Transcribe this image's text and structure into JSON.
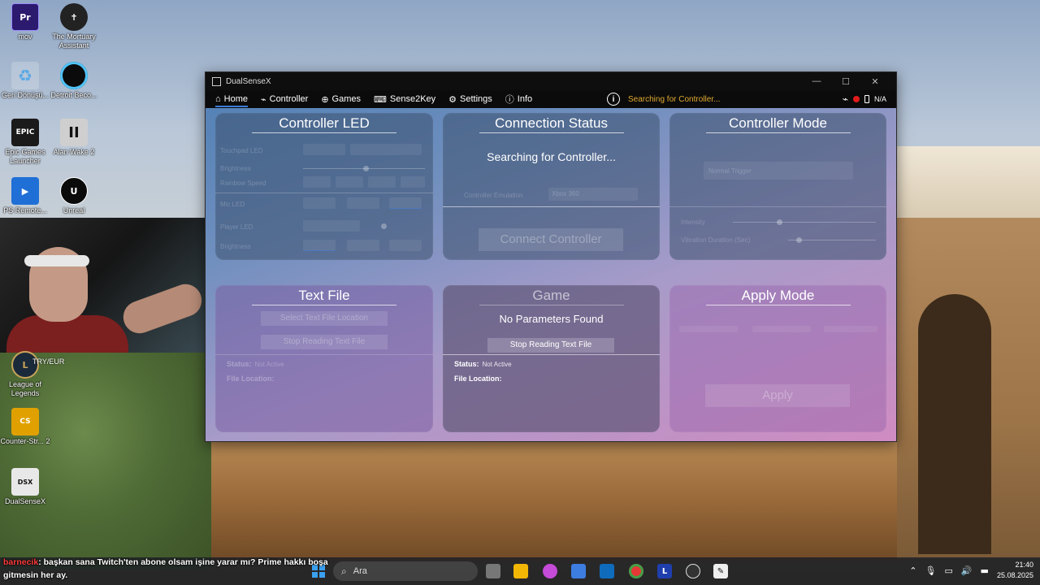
{
  "desktop": {
    "icons": [
      {
        "label": "mov",
        "glyph": "Pr",
        "color": "#2b1a6e"
      },
      {
        "label": "The Mortuary Assistant",
        "glyph": "",
        "color": "#222222"
      },
      {
        "label": "Geri Dönüşü...",
        "glyph": "♻",
        "color": "#5aa9e6"
      },
      {
        "label": "Detroit Beco...",
        "glyph": "",
        "color": "#0b0b0b"
      },
      {
        "label": "Epic Games Launcher",
        "glyph": "EPIC",
        "color": "#1a1a1a"
      },
      {
        "label": "Alan Wake 2",
        "glyph": "II",
        "color": "#cfcfcf"
      },
      {
        "label": "PS Remote...",
        "glyph": "▶",
        "color": "#1f6fd6"
      },
      {
        "label": "Unreal",
        "glyph": "U",
        "color": "#0b0b0b"
      },
      {
        "label": "League of Legends",
        "glyph": "L",
        "color": "#1b2a3a"
      },
      {
        "label": "Counter-Str... 2",
        "glyph": "CS",
        "color": "#e0a100"
      },
      {
        "label": "DualSenseX",
        "glyph": "DSX",
        "color": "#e8e8e8"
      }
    ],
    "mortuary_extra": "TRY/EUR"
  },
  "window": {
    "title": "DualSenseX",
    "controls": {
      "minimize": "—",
      "maximize": "☐",
      "close": "✕"
    },
    "nav": [
      {
        "label": "Home",
        "icon": "home-icon",
        "glyph": "⌂"
      },
      {
        "label": "Controller",
        "icon": "gamepad-icon",
        "glyph": "🎮"
      },
      {
        "label": "Games",
        "icon": "games-icon",
        "glyph": "⊕"
      },
      {
        "label": "Sense2Key",
        "icon": "keyboard-icon",
        "glyph": "⌨"
      },
      {
        "label": "Settings",
        "icon": "settings-icon",
        "glyph": "⚙"
      },
      {
        "label": "Info",
        "icon": "info-icon",
        "glyph": "ⓘ"
      }
    ],
    "status_text": "Searching for Controller...",
    "battery_text": "N/A"
  },
  "panels": {
    "controller_led": {
      "title": "Controller LED",
      "touchpad_led": "Touchpad LED",
      "brightness": "Brightness",
      "rainbow_speed": "Rainbow Speed",
      "mic_led": "Mic LED",
      "player_led": "Player LED",
      "brightness2": "Brightness"
    },
    "connection_status": {
      "title": "Connection Status",
      "message": "Searching for Controller...",
      "emulation_label": "Controller Emulation",
      "emulation_value": "Xbox 360",
      "connect_button": "Connect Controller"
    },
    "controller_mode": {
      "title": "Controller Mode",
      "mode_value": "Normal Trigger",
      "intensity": "Intensity",
      "vibration": "Vibration Duration (Sec)"
    },
    "text_file": {
      "title": "Text File",
      "select_button": "Select Text File Location",
      "stop_button": "Stop Reading Text File",
      "status_label": "Status:",
      "status_value": "Not Active",
      "file_location": "File Location:"
    },
    "game": {
      "title": "Game",
      "message": "No Parameters Found",
      "stop_button": "Stop Reading Text File",
      "status_label": "Status:",
      "status_value": "Not Active",
      "file_location": "File Location:"
    },
    "apply_mode": {
      "title": "Apply Mode",
      "apply_button": "Apply"
    }
  },
  "chat": {
    "user": "barnecik",
    "message": ": başkan sana Twitch'ten abone olsam işine yarar mı? Prime hakkı boşa gitmesin her ay."
  },
  "taskbar": {
    "search_placeholder": "Ara",
    "time": "21:40",
    "date": "25.08.2025"
  }
}
